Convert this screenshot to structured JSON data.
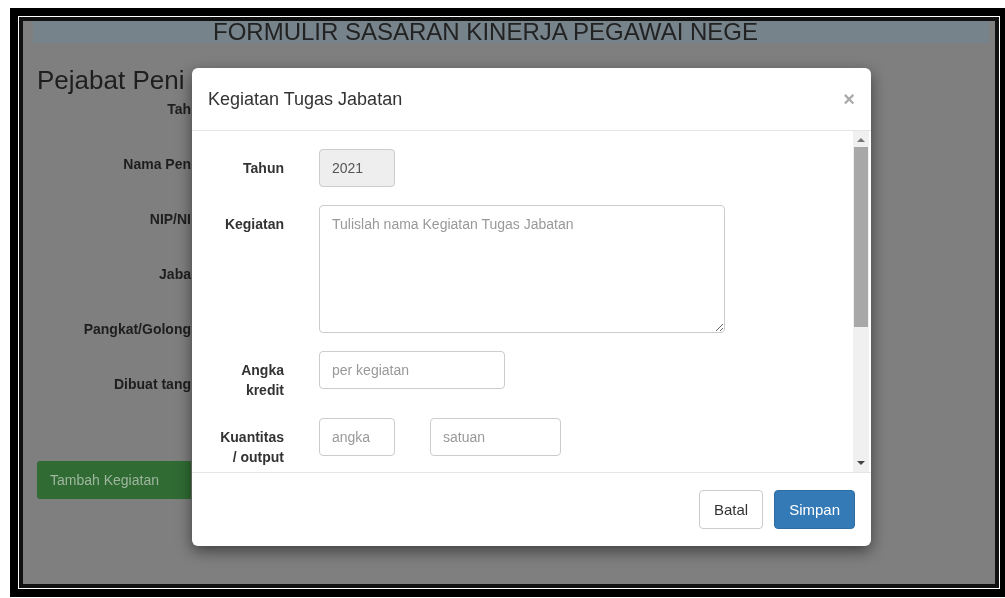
{
  "page": {
    "heading": "FORMULIR SASARAN KINERJA PEGAWAI NEGE",
    "section_title": "Pejabat Peni",
    "labels": [
      "Tah",
      "Nama Pen",
      "NIP/NI",
      "Jaba",
      "Pangkat/Golong",
      "Dibuat tang"
    ],
    "add_button": "Tambah Kegiatan"
  },
  "modal": {
    "title": "Kegiatan Tugas Jabatan",
    "close": "×",
    "fields": [
      {
        "kind": "input",
        "label": "Tahun",
        "value": "2021",
        "disabled": true
      },
      {
        "kind": "textarea",
        "label": "Kegiatan",
        "placeholder": "Tulislah nama Kegiatan Tugas Jabatan"
      },
      {
        "kind": "input",
        "label": "Angka kredit",
        "placeholder": "per kegiatan",
        "disabled": false
      },
      {
        "kind": "pair",
        "label": "Kuantitas / output",
        "placeholders": [
          "angka",
          "satuan"
        ]
      }
    ],
    "buttons": [
      {
        "label": "Batal",
        "kind": "default"
      },
      {
        "label": "Simpan",
        "kind": "primary"
      }
    ]
  }
}
